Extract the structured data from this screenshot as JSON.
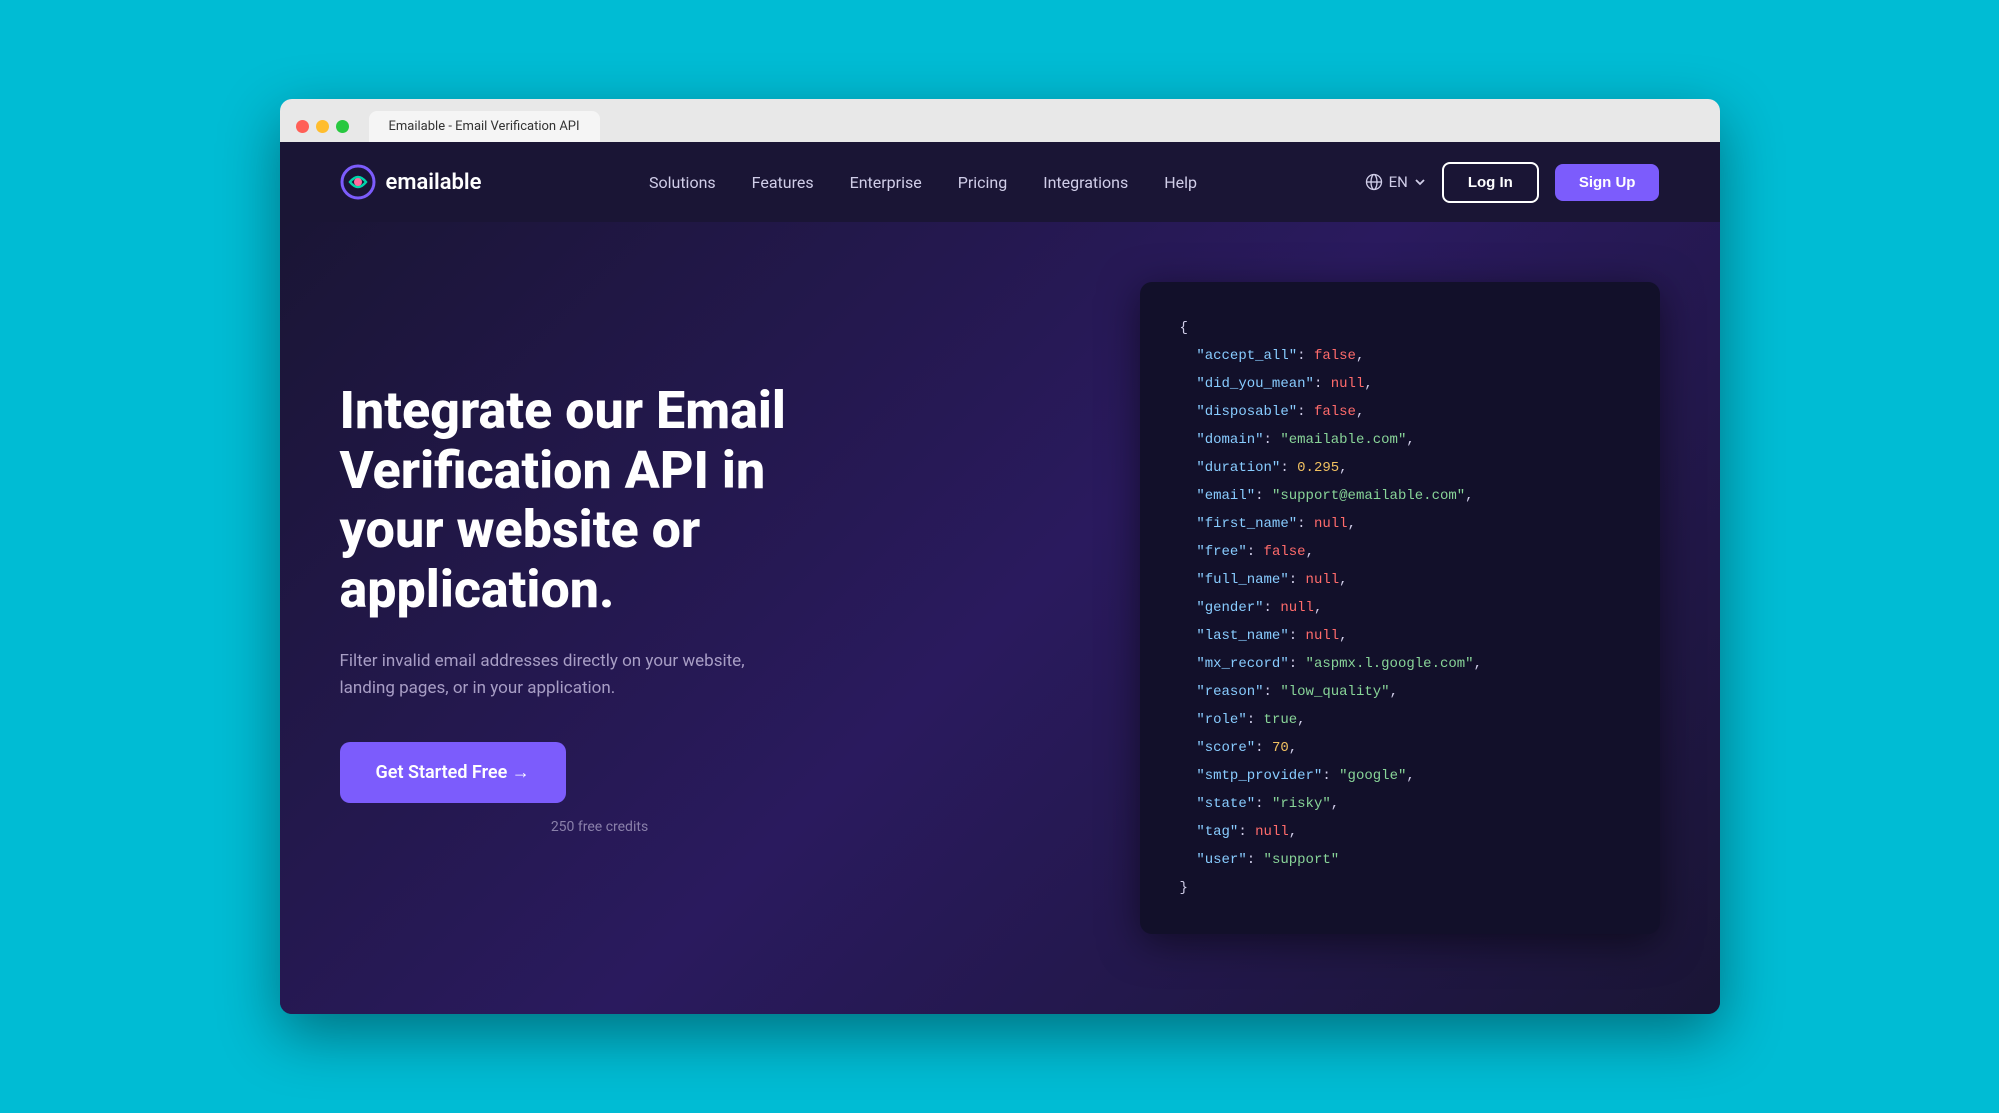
{
  "browser": {
    "tab_label": "Emailable - Email Verification API"
  },
  "nav": {
    "logo_text": "emailable",
    "links": [
      {
        "label": "Solutions",
        "href": "#"
      },
      {
        "label": "Features",
        "href": "#"
      },
      {
        "label": "Enterprise",
        "href": "#"
      },
      {
        "label": "Pricing",
        "href": "#"
      },
      {
        "label": "Integrations",
        "href": "#"
      },
      {
        "label": "Help",
        "href": "#"
      }
    ],
    "lang": "EN",
    "login_label": "Log In",
    "signup_label": "Sign Up"
  },
  "hero": {
    "title": "Integrate our Email Verification API in your website or application.",
    "subtitle": "Filter invalid email addresses directly on your website, landing pages, or in your application.",
    "cta_label": "Get Started Free →",
    "free_credits": "250 free credits"
  },
  "code": {
    "lines": [
      {
        "key": null,
        "value": "{",
        "type": "brace"
      },
      {
        "key": "accept_all",
        "value": "false",
        "type": "false"
      },
      {
        "key": "did_you_mean",
        "value": "null",
        "type": "null"
      },
      {
        "key": "disposable",
        "value": "false",
        "type": "false"
      },
      {
        "key": "domain",
        "value": "\"emailable.com\"",
        "type": "string"
      },
      {
        "key": "duration",
        "value": "0.295",
        "type": "number"
      },
      {
        "key": "email",
        "value": "\"support@emailable.com\"",
        "type": "string"
      },
      {
        "key": "first_name",
        "value": "null",
        "type": "null"
      },
      {
        "key": "free",
        "value": "false",
        "type": "false"
      },
      {
        "key": "full_name",
        "value": "null",
        "type": "null"
      },
      {
        "key": "gender",
        "value": "null",
        "type": "null"
      },
      {
        "key": "last_name",
        "value": "null",
        "type": "null"
      },
      {
        "key": "mx_record",
        "value": "\"aspmx.l.google.com\"",
        "type": "string"
      },
      {
        "key": "reason",
        "value": "\"low_quality\"",
        "type": "string"
      },
      {
        "key": "role",
        "value": "true",
        "type": "true"
      },
      {
        "key": "score",
        "value": "70",
        "type": "number"
      },
      {
        "key": "smtp_provider",
        "value": "\"google\"",
        "type": "string"
      },
      {
        "key": "state",
        "value": "\"risky\"",
        "type": "string"
      },
      {
        "key": "tag",
        "value": "null",
        "type": "null"
      },
      {
        "key": "user",
        "value": "\"support\"",
        "type": "string"
      },
      {
        "key": null,
        "value": "}",
        "type": "brace"
      }
    ]
  },
  "colors": {
    "bg_primary": "#1a1535",
    "bg_code": "#12102a",
    "accent": "#7c5cfc",
    "teal": "#00bcd4"
  }
}
